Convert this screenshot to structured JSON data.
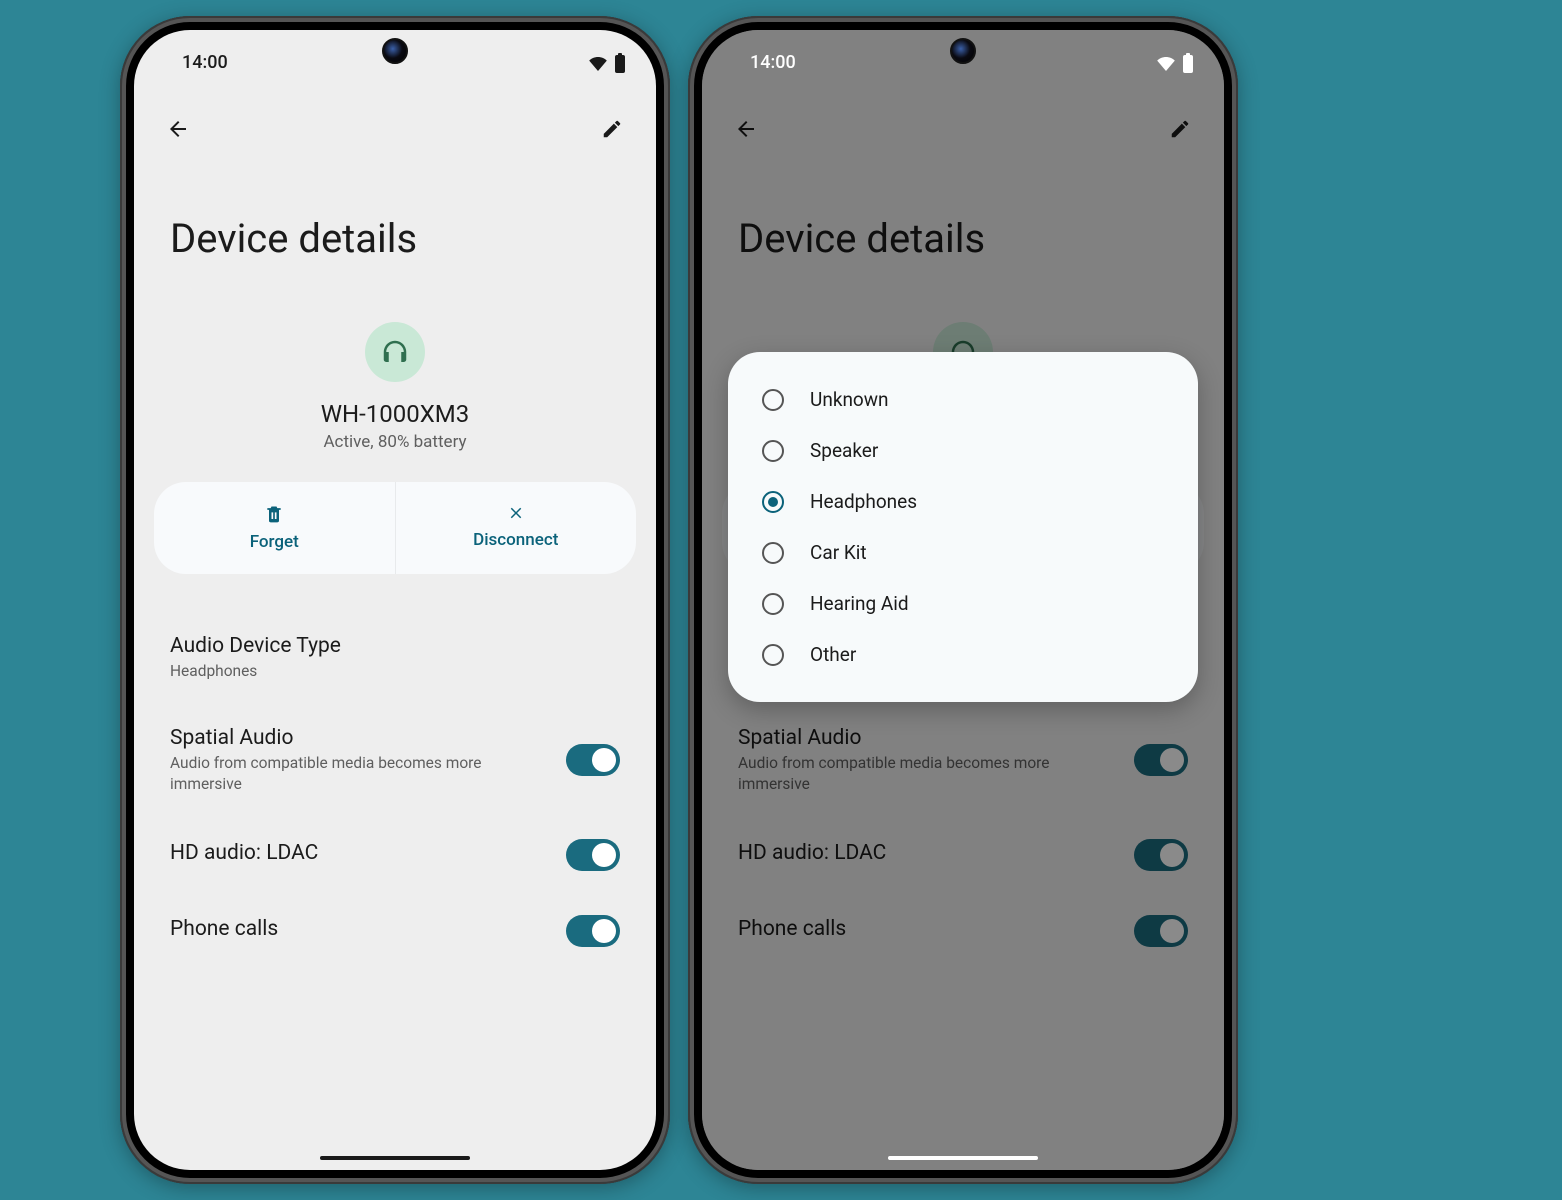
{
  "status": {
    "time": "14:00"
  },
  "page": {
    "title": "Device details"
  },
  "device": {
    "name": "WH-1000XM3",
    "status": "Active, 80% battery"
  },
  "actions": {
    "forget": "Forget",
    "disconnect": "Disconnect"
  },
  "settings": {
    "audioType": {
      "title": "Audio Device Type",
      "value": "Headphones"
    },
    "spatial": {
      "title": "Spatial Audio",
      "sub": "Audio from compatible media becomes more immersive",
      "on": true
    },
    "hd": {
      "title": "HD audio: LDAC",
      "on": true
    },
    "calls": {
      "title": "Phone calls",
      "on": true
    }
  },
  "dialog": {
    "options": [
      {
        "label": "Unknown",
        "selected": false
      },
      {
        "label": "Speaker",
        "selected": false
      },
      {
        "label": "Headphones",
        "selected": true
      },
      {
        "label": "Car Kit",
        "selected": false
      },
      {
        "label": "Hearing Aid",
        "selected": false
      },
      {
        "label": "Other",
        "selected": false
      }
    ]
  }
}
